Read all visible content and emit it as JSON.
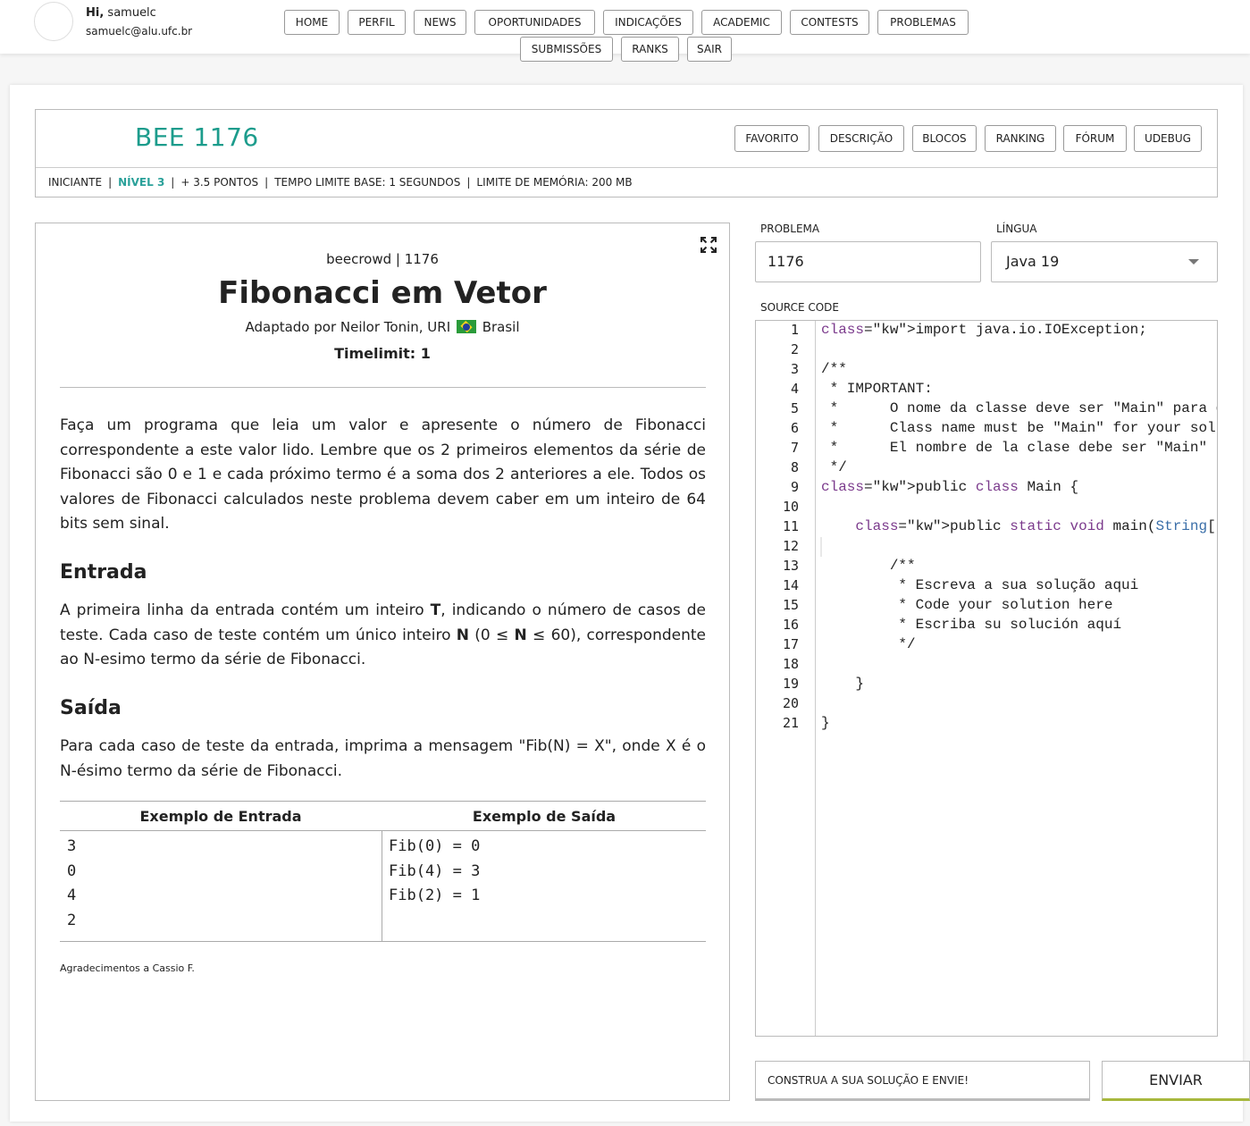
{
  "user": {
    "greeting": "Hi,",
    "name": "samuelc",
    "email": "samuelc@alu.ufc.br"
  },
  "nav": [
    "HOME",
    "PERFIL",
    "NEWS",
    "OPORTUNIDADES",
    "INDICAÇÕES",
    "ACADEMIC",
    "CONTESTS",
    "PROBLEMAS",
    "SUBMISSÕES",
    "RANKS",
    "SAIR"
  ],
  "problem_header": {
    "title": "BEE 1176",
    "tabs": [
      "FAVORITO",
      "DESCRIÇÃO",
      "BLOCOS",
      "RANKING",
      "FÓRUM",
      "UDEBUG"
    ],
    "category": "INICIANTE",
    "level": "NÍVEL 3",
    "points": "+ 3.5 PONTOS",
    "time_limit": "TEMPO LIMITE BASE: 1 SEGUNDOS",
    "memory_limit": "LIMITE DE MEMÓRIA: 200 MB"
  },
  "description": {
    "source": "beecrowd | 1176",
    "title": "Fibonacci em Vetor",
    "author_prefix": "Adaptado por Neilor Tonin, URI",
    "author_country": "Brasil",
    "timelimit": "Timelimit: 1",
    "intro": "Faça um programa que leia um valor e apresente o número de Fibonacci correspondente a este valor lido. Lembre que os 2 primeiros elementos da série de Fibonacci são 0 e 1 e cada próximo termo é a soma dos 2 anteriores a ele. Todos os valores de Fibonacci calculados neste problema devem caber em um inteiro de 64 bits sem sinal.",
    "input_heading": "Entrada",
    "input_text": {
      "p1": "A primeira linha da entrada contém um inteiro ",
      "b1": "T",
      "p2": ", indicando o número de casos de teste. Cada caso de teste contém um único inteiro ",
      "b2": "N",
      "p3": " (0 ≤ ",
      "b3": "N",
      "p4": " ≤ 60), correspondente ao N-esimo termo da série de Fibonacci."
    },
    "output_heading": "Saída",
    "output_text": "Para cada caso de teste da entrada, imprima a mensagem \"Fib(N) = X\", onde X é o N-ésimo termo da série de Fibonacci.",
    "example_input_heading": "Exemplo de Entrada",
    "example_output_heading": "Exemplo de Saída",
    "example_input": "3\n0\n4\n2",
    "example_output": "Fib(0) = 0\nFib(4) = 3\nFib(2) = 1",
    "thanks": "Agradecimentos a Cassio F."
  },
  "editor": {
    "problem_label": "PROBLEMA",
    "problem_value": "1176",
    "language_label": "LÍNGUA",
    "language_value": "Java 19",
    "source_label": "SOURCE CODE",
    "lines": [
      "import java.io.IOException;",
      "",
      "/**",
      " * IMPORTANT:",
      " *      O nome da classe deve ser \"Main\" para que a sua solução execute",
      " *      Class name must be \"Main\" for your solution to execute",
      " *      El nombre de la clase debe ser \"Main\" para que su solución ejecutar",
      " */",
      "public class Main {",
      "",
      "    public static void main(String[] args) throws IOException {",
      "",
      "        /**",
      "         * Escreva a sua solução aqui",
      "         * Code your solution here",
      "         * Escriba su solución aquí",
      "         */",
      "",
      "    }",
      "",
      "}"
    ],
    "hint": "CONSTRUA A SUA SOLUÇÃO E ENVIE!",
    "submit": "ENVIAR"
  },
  "colors": {
    "brand_teal": "#1c9c8c",
    "level_green": "#2ba19a",
    "submit_accent": "#a7b83d",
    "keyword": "#7b3a8c",
    "type": "#3a6ea8"
  },
  "icons": {
    "expand": "expand-icon",
    "flag": "brazil-flag-icon",
    "dropdown": "chevron-down-icon"
  }
}
